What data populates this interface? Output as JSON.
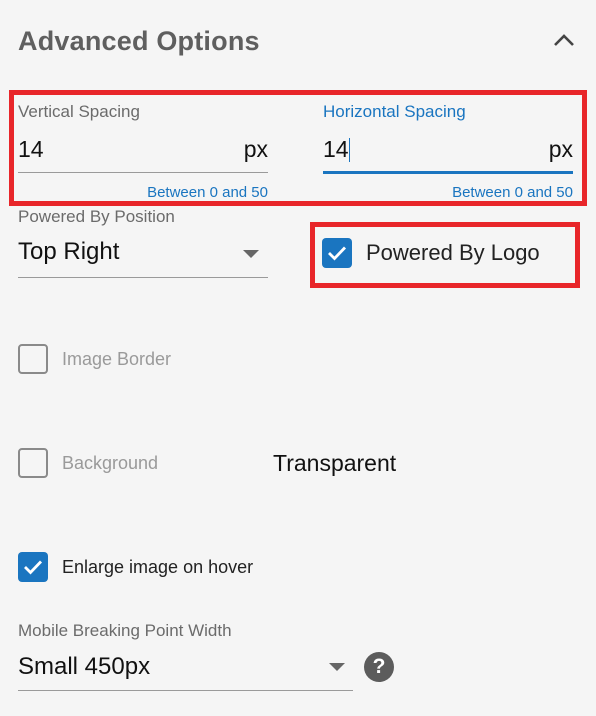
{
  "panel": {
    "title": "Advanced Options"
  },
  "vertical_spacing": {
    "label": "Vertical Spacing",
    "value": "14",
    "unit": "px",
    "helper": "Between 0 and 50"
  },
  "horizontal_spacing": {
    "label": "Horizontal Spacing",
    "value": "14",
    "unit": "px",
    "helper": "Between 0 and 50"
  },
  "powered_by_position": {
    "label": "Powered By Position",
    "value": "Top Right"
  },
  "powered_by_logo": {
    "label": "Powered By Logo",
    "checked": true
  },
  "image_border": {
    "label": "Image Border",
    "checked": false
  },
  "background": {
    "label": "Background",
    "checked": false,
    "value_text": "Transparent"
  },
  "enlarge_on_hover": {
    "label": "Enlarge image on hover",
    "checked": true
  },
  "mobile_breakpoint": {
    "label": "Mobile Breaking Point Width",
    "value": "Small 450px"
  },
  "colors": {
    "accent": "#1a75c0",
    "highlight": "#e8262a",
    "title": "#5f5f5f"
  }
}
